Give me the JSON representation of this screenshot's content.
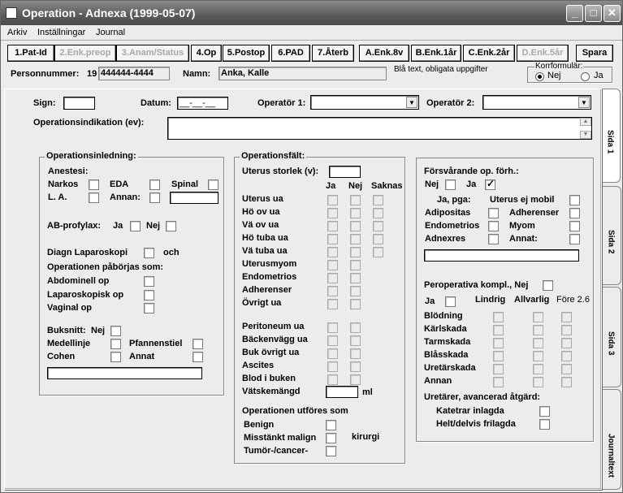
{
  "window": {
    "title": "Operation - Adnexa (1999-05-07)",
    "min_btn": "_",
    "max_btn": "□",
    "close_btn": "✕"
  },
  "menu": [
    "Arkiv",
    "Inställningar",
    "Journal"
  ],
  "nav": {
    "buttons": [
      "1.Pat-Id",
      "2.Enk.preop",
      "3.Anam/Status",
      "4.Op",
      "5.Postop",
      "6.PAD",
      "7.Återb",
      "A.Enk.8v",
      "B.Enk.1år",
      "C.Enk.2år",
      "D.Enk.5år"
    ],
    "save": "Spara"
  },
  "patient": {
    "pnr_label": "Personnummer:",
    "pnr_prefix": "19",
    "pnr_value": "444444-4444",
    "name_label": "Namn:",
    "name_value": "Anka, Kalle",
    "note": "Blå text, obligata uppgifter",
    "korr_label": "Korrformulär:",
    "korr_no": "Nej",
    "korr_yes": "Ja"
  },
  "tabs": [
    "Sida 1",
    "Sida 2",
    "Sida 3",
    "Journaltext"
  ],
  "top": {
    "sign_label": "Sign:",
    "datum_label": "Datum:",
    "datum_value": "__-__-__",
    "op1_label": "Operatör 1:",
    "op2_label": "Operatör 2:",
    "indik_label": "Operationsindikation (ev):"
  },
  "inledning": {
    "title": "Operationsinledning:",
    "anestesi": "Anestesi:",
    "narkos": "Narkos",
    "eda": "EDA",
    "spinal": "Spinal",
    "la": "L. A.",
    "annan": "Annan:",
    "ab_label": "AB-profylax:",
    "ja": "Ja",
    "nej": "Nej",
    "diagn": "Diagn Laparoskopi",
    "och": "och",
    "paborjas": "Operationen påbörjas som:",
    "abdominell": "Abdominell op",
    "laparoskopisk": "Laparoskopisk op",
    "vaginal": "Vaginal op",
    "buksnitt": "Buksnitt:",
    "medellinje": "Medellinje",
    "pfannenstiel": "Pfannenstiel",
    "cohen": "Cohen",
    "annat": "Annat"
  },
  "faltet": {
    "title": "Operationsfält:",
    "uterus_storlek": "Uterus storlek (v):",
    "col_ja": "Ja",
    "col_nej": "Nej",
    "col_saknas": "Saknas",
    "rows1": [
      "Uterus ua",
      "Hö ov ua",
      "Vä ov ua",
      "Hö tuba ua",
      "Vä tuba ua",
      "Uterusmyom",
      "Endometrios",
      "Adherenser",
      "Övrigt ua"
    ],
    "rows2": [
      "Peritoneum ua",
      "Bäckenvägg ua",
      "Buk övrigt ua",
      "Ascites",
      "Blod i buken"
    ],
    "vatske": "Vätskemängd",
    "ml": "ml",
    "utfores": "Operationen utföres som",
    "benign": "Benign",
    "misstankt": "Misstänkt malign",
    "kirurgi": "kirurgi",
    "tumor": "Tumör-/cancer-"
  },
  "forsvar": {
    "title": "Försvårande op. förh.:",
    "nej": "Nej",
    "ja": "Ja",
    "ja_pga": "Ja, pga:",
    "uterus_ej_mobil": "Uterus ej mobil",
    "adipositas": "Adipositas",
    "adherenser": "Adherenser",
    "endometrios": "Endometrios",
    "myom": "Myom",
    "adnexres": "Adnexres",
    "annat": "Annat:",
    "perop": "Peroperativa kompl., Nej",
    "perop_ja": "Ja",
    "lindrig": "Lindrig",
    "allvarlig": "Allvarlig",
    "fore": "Före 2.6",
    "kompl_rows": [
      "Blödning",
      "Kärlskada",
      "Tarmskada",
      "Blåsskada",
      "Uretärskada",
      "Annan"
    ],
    "ureter": "Uretärer, avancerad åtgärd:",
    "katetrar": "Katetrar inlagda",
    "frilagda": "Helt/delvis frilagda"
  }
}
